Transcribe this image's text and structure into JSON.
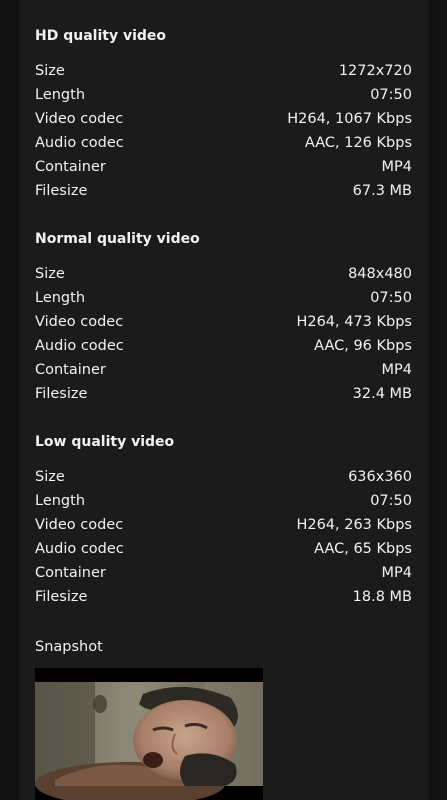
{
  "sections": [
    {
      "title": "HD quality video",
      "rows": [
        {
          "label": "Size",
          "value": "1272x720"
        },
        {
          "label": "Length",
          "value": "07:50"
        },
        {
          "label": "Video codec",
          "value": "H264, 1067 Kbps"
        },
        {
          "label": "Audio codec",
          "value": "AAC, 126 Kbps"
        },
        {
          "label": "Container",
          "value": "MP4"
        },
        {
          "label": "Filesize",
          "value": "67.3 MB"
        }
      ]
    },
    {
      "title": "Normal quality video",
      "rows": [
        {
          "label": "Size",
          "value": "848x480"
        },
        {
          "label": "Length",
          "value": "07:50"
        },
        {
          "label": "Video codec",
          "value": "H264, 473 Kbps"
        },
        {
          "label": "Audio codec",
          "value": "AAC, 96 Kbps"
        },
        {
          "label": "Container",
          "value": "MP4"
        },
        {
          "label": "Filesize",
          "value": "32.4 MB"
        }
      ]
    },
    {
      "title": "Low quality video",
      "rows": [
        {
          "label": "Size",
          "value": "636x360"
        },
        {
          "label": "Length",
          "value": "07:50"
        },
        {
          "label": "Video codec",
          "value": "H264, 263 Kbps"
        },
        {
          "label": "Audio codec",
          "value": "AAC, 65 Kbps"
        },
        {
          "label": "Container",
          "value": "MP4"
        },
        {
          "label": "Filesize",
          "value": "18.8 MB"
        }
      ]
    }
  ],
  "snapshot": {
    "label": "Snapshot"
  }
}
